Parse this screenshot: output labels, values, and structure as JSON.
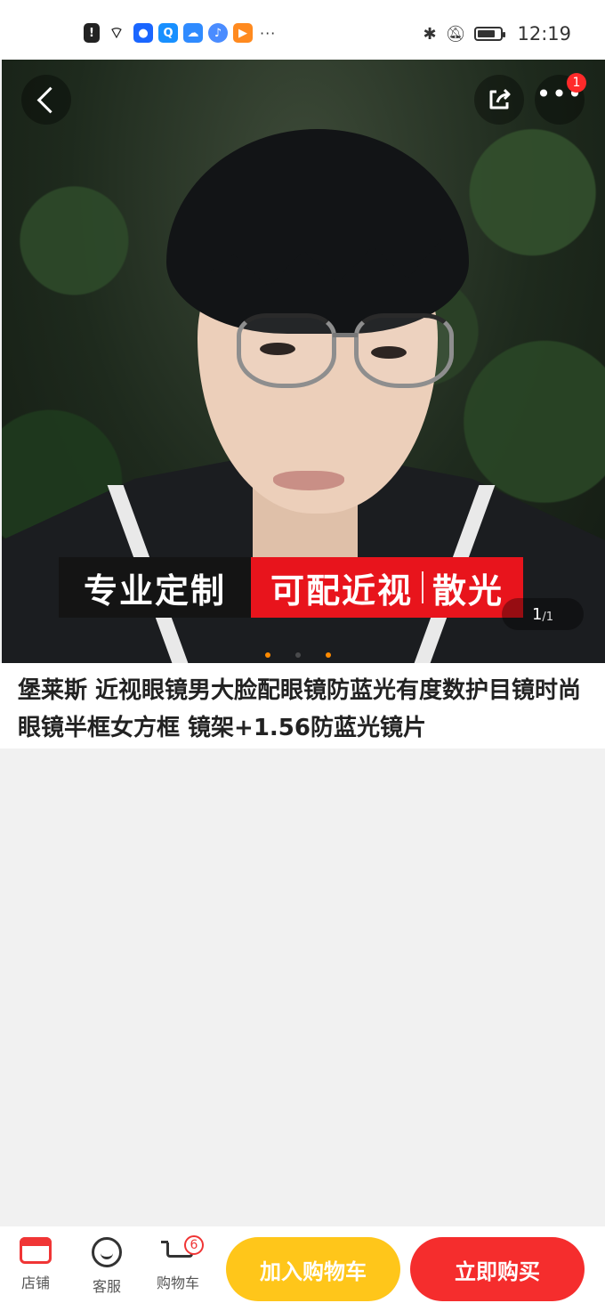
{
  "status_bar": {
    "time": "12:19",
    "left_icons": [
      "alert-icon",
      "wifi-icon",
      "bulb-icon",
      "search-app-icon",
      "cloud-icon",
      "music-icon",
      "video-icon"
    ],
    "more": "···",
    "battery_level": 0.8
  },
  "hero": {
    "promo_left": "专业定制",
    "promo_mid": "可配近视",
    "promo_right": "散光",
    "page_current": "1",
    "page_total": "/1",
    "more_badge": "1"
  },
  "product": {
    "title": "堡莱斯 近视眼镜男大脸配眼镜防蓝光有度数护目镜时尚眼镜半框女方框 镜架+1.56防蓝光镜片"
  },
  "bottom_bar": {
    "store_label": "店铺",
    "service_label": "客服",
    "cart_label": "购物车",
    "cart_count": "6",
    "add_to_cart": "加入购物车",
    "buy_now": "立即购买"
  },
  "colors": {
    "accent_yellow": "#ffc61a",
    "accent_red": "#f52d2d",
    "promo_red": "#e8141c"
  }
}
